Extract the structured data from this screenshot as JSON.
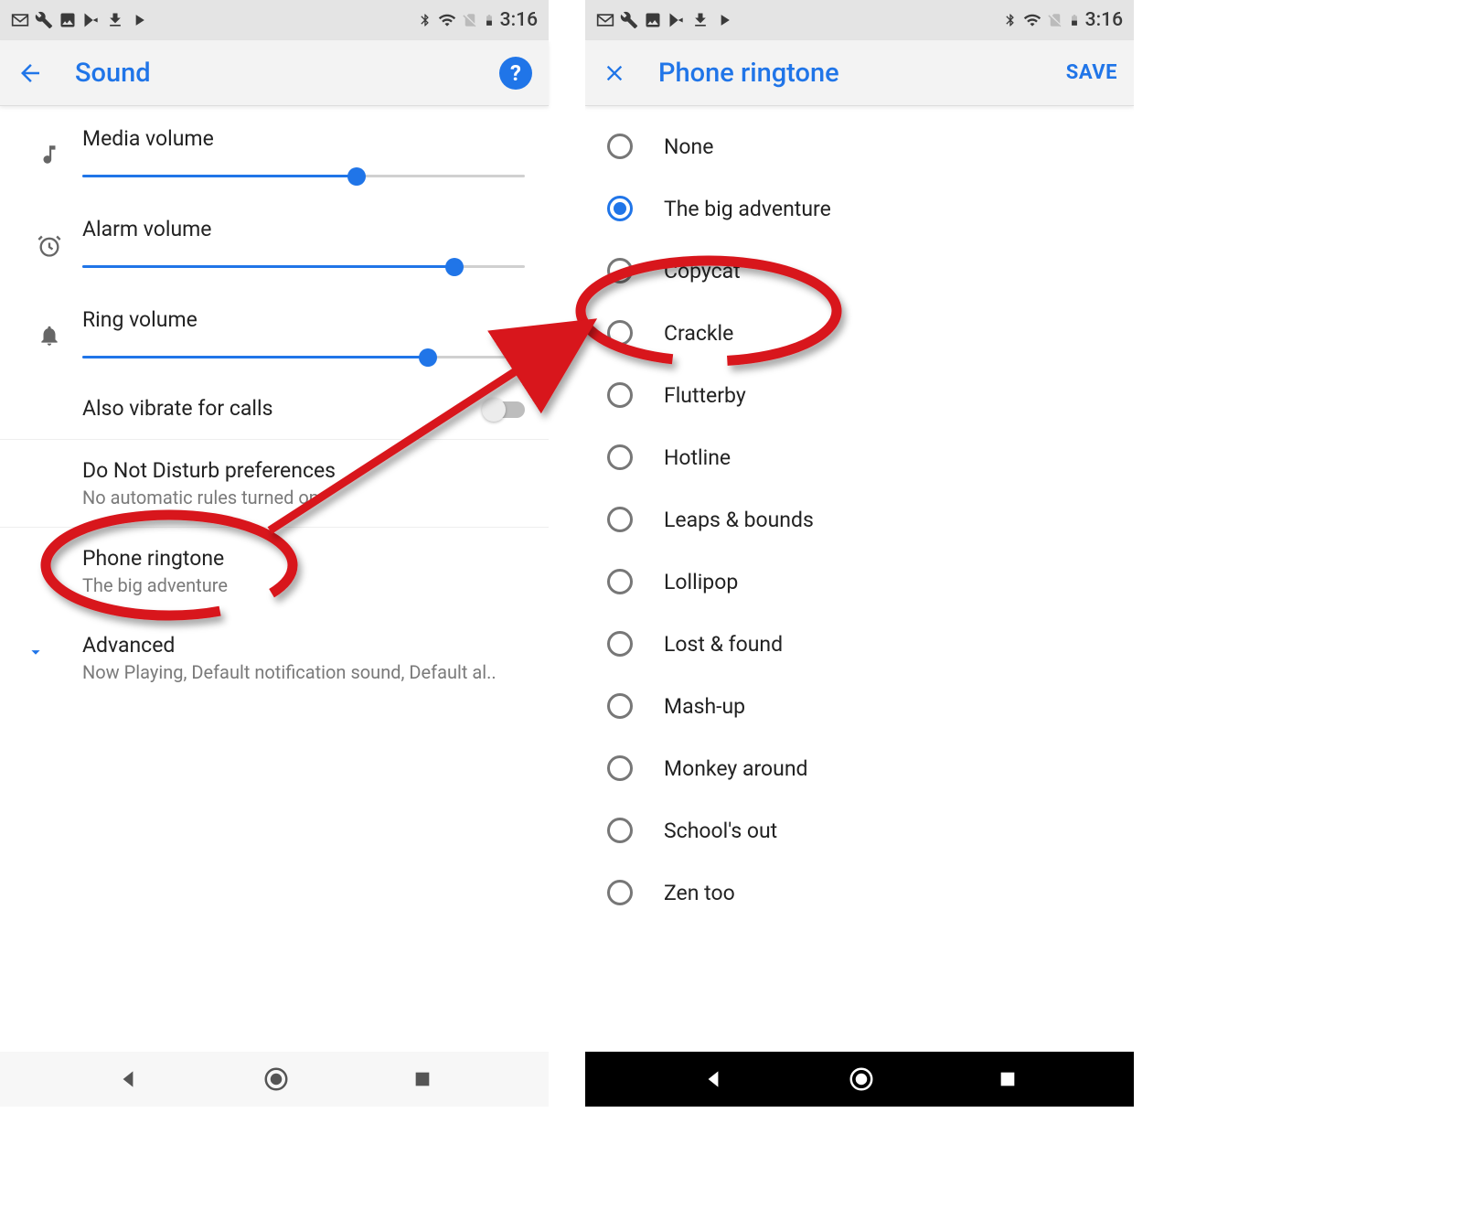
{
  "status_bar": {
    "time": "3:16"
  },
  "left_screen": {
    "title": "Sound",
    "volumes": [
      {
        "label": "Media volume",
        "icon": "music-note",
        "value": 62
      },
      {
        "label": "Alarm volume",
        "icon": "alarm-clock",
        "value": 84
      },
      {
        "label": "Ring volume",
        "icon": "bell",
        "value": 78
      }
    ],
    "vibrate": {
      "label": "Also vibrate for calls",
      "on": false
    },
    "dnd": {
      "title": "Do Not Disturb preferences",
      "subtitle": "No automatic rules turned on"
    },
    "ringtone": {
      "title": "Phone ringtone",
      "subtitle": "The big adventure"
    },
    "advanced": {
      "title": "Advanced",
      "subtitle": "Now Playing, Default notification sound, Default al.."
    }
  },
  "right_screen": {
    "title": "Phone ringtone",
    "save_label": "SAVE",
    "selected_index": 1,
    "items": [
      "None",
      "The big adventure",
      "Copycat",
      "Crackle",
      "Flutterby",
      "Hotline",
      "Leaps & bounds",
      "Lollipop",
      "Lost & found",
      "Mash-up",
      "Monkey around",
      "School's out",
      "Zen too"
    ]
  },
  "annotation": {
    "circled_left": "Phone ringtone",
    "circled_right": "Crackle"
  }
}
